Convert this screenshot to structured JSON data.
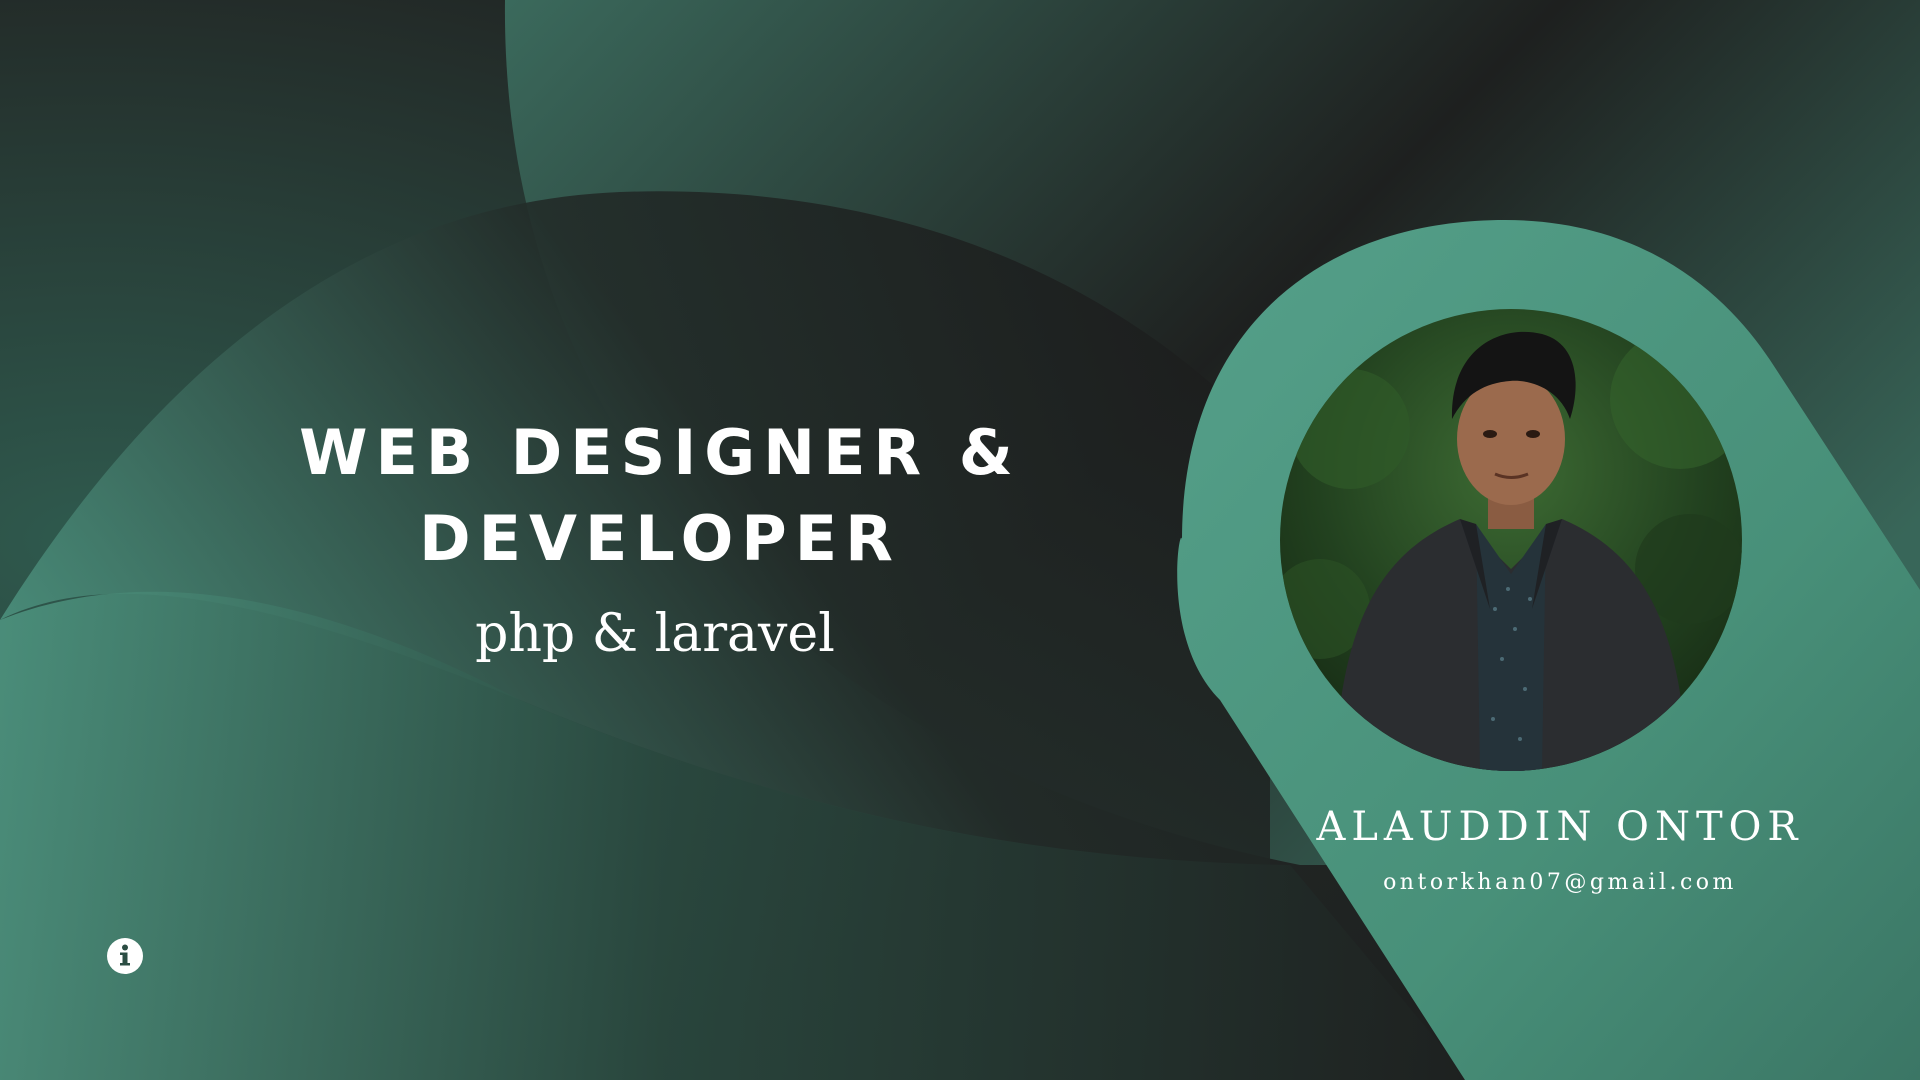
{
  "headline": {
    "line1": "WEB DESIGNER &",
    "line2": "DEVELOPER"
  },
  "subtitle": "php & laravel",
  "profile": {
    "name": "ALAUDDIN ONTOR",
    "email": "ontorkhan07@gmail.com",
    "photo_icon": "profile-photo"
  },
  "info_button": {
    "icon": "info-icon"
  },
  "colors": {
    "background_dark": "#1d1e1e",
    "accent_green": "#4f9782",
    "deep_green": "#2f5a4e",
    "text": "#ffffff"
  }
}
